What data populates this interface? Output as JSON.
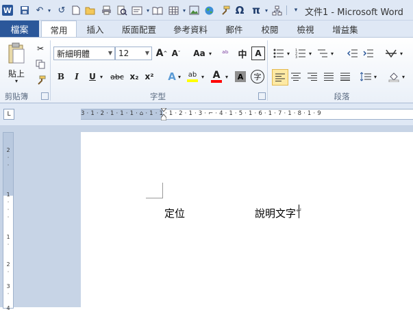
{
  "window": {
    "title": "文件1 - Microsoft Word"
  },
  "qat": {
    "icons": [
      "word-logo-icon",
      "save-icon",
      "undo-icon",
      "redo-icon",
      "new-icon",
      "open-icon",
      "print-icon",
      "print-preview-icon",
      "text-box-icon",
      "book-icon",
      "table-icon",
      "picture-icon",
      "globe-icon",
      "format-painter-icon",
      "omega-icon",
      "pi-icon",
      "shapes-icon"
    ],
    "omega": "Ω",
    "pi": "π"
  },
  "tabs": {
    "file": "檔案",
    "items": [
      "常用",
      "插入",
      "版面配置",
      "參考資料",
      "郵件",
      "校閱",
      "檢視",
      "增益集"
    ]
  },
  "ribbon": {
    "clipboard": {
      "paste_label": "貼上",
      "group_label": "剪貼簿"
    },
    "font": {
      "font_name": "新細明體",
      "font_size": "12",
      "group_label": "字型",
      "bold": "B",
      "italic": "I",
      "underline": "U",
      "strike": "abc",
      "subscript": "x₂",
      "superscript": "x²",
      "grow": "A",
      "shrink": "A",
      "case": "Aa",
      "clear": "A",
      "highlight": "ab",
      "font_color": "A",
      "char_shade": "A",
      "enclose": "字"
    },
    "paragraph": {
      "group_label": "段落"
    }
  },
  "ruler": {
    "horizontal": "3 · 1 · 2 · 1 · 1 · 1 · ⌂ · 1 · 1 · 1 · 2 · 1 · 3 · ⌐ · 4 · 1 · 5 · 1 · 6 · 1 · 7 · 1 · 8 · 1 · 9",
    "vertical": [
      "2",
      "·",
      "·",
      "1",
      "·",
      "·",
      "·",
      "1",
      "·",
      "2",
      "·",
      "3",
      "·",
      "4"
    ]
  },
  "document": {
    "label1": "定位",
    "label2": "說明文字",
    "para_mark": "↵"
  },
  "colors": {
    "file_tab": "#2b579a",
    "highlight": "#ffff00",
    "font_color": "#ff0000",
    "selected_button": "#fde9a4"
  }
}
